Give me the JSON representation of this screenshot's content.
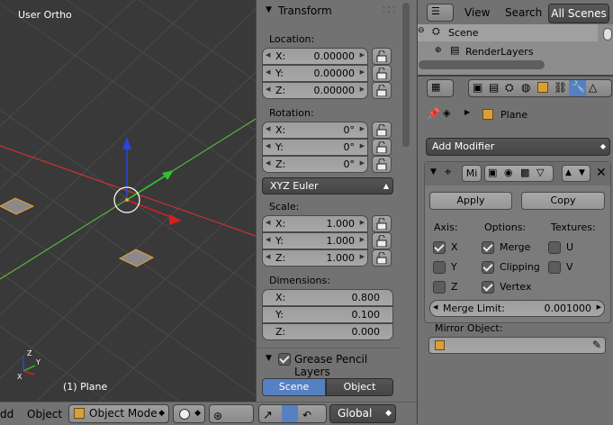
{
  "viewport": {
    "title": "User Ortho",
    "object_label": "(1) Plane"
  },
  "npanel": {
    "transform_title": "Transform",
    "location_label": "Location:",
    "location": [
      {
        "axis": "X:",
        "value": "0.00000"
      },
      {
        "axis": "Y:",
        "value": "0.00000"
      },
      {
        "axis": "Z:",
        "value": "0.00000"
      }
    ],
    "rotation_label": "Rotation:",
    "rotation": [
      {
        "axis": "X:",
        "value": "0°"
      },
      {
        "axis": "Y:",
        "value": "0°"
      },
      {
        "axis": "Z:",
        "value": "0°"
      }
    ],
    "rotation_mode": "XYZ Euler",
    "scale_label": "Scale:",
    "scale": [
      {
        "axis": "X:",
        "value": "1.000"
      },
      {
        "axis": "Y:",
        "value": "1.000"
      },
      {
        "axis": "Z:",
        "value": "1.000"
      }
    ],
    "dimensions_label": "Dimensions:",
    "dimensions": [
      {
        "axis": "X:",
        "value": "0.800"
      },
      {
        "axis": "Y:",
        "value": "0.100"
      },
      {
        "axis": "Z:",
        "value": "0.000"
      }
    ],
    "grease_title": "Grease Pencil Layers",
    "grease_tabs": [
      "Scene",
      "Object"
    ]
  },
  "header": {
    "add_menu": "dd",
    "object_menu": "Object",
    "mode": "Object Mode",
    "orientation": "Global"
  },
  "outliner": {
    "view_menu": "View",
    "search_menu": "Search",
    "filter": "All Scenes",
    "rows": [
      "Scene",
      "RenderLayers"
    ]
  },
  "properties": {
    "context_object": "Plane",
    "add_modifier": "Add Modifier",
    "modifier_short_name": "Mi",
    "apply_button": "Apply",
    "copy_button": "Copy",
    "axis_label": "Axis:",
    "options_label": "Options:",
    "textures_label": "Textures:",
    "axis": [
      {
        "label": "X",
        "checked": true
      },
      {
        "label": "Y",
        "checked": false
      },
      {
        "label": "Z",
        "checked": false
      }
    ],
    "options": [
      {
        "label": "Merge",
        "checked": true
      },
      {
        "label": "Clipping",
        "checked": true
      },
      {
        "label": "Vertex",
        "checked": true
      }
    ],
    "textures": [
      {
        "label": "U",
        "checked": false
      },
      {
        "label": "V",
        "checked": false
      }
    ],
    "merge_limit_label": "Merge Limit:",
    "merge_limit_value": "0.001000",
    "mirror_object_label": "Mirror Object:"
  },
  "colors": {
    "viewport_bg": "#393939",
    "x_axis": "#c83232",
    "y_axis": "#5ab43c",
    "selected_outline": "#f0a030",
    "active_tab": "#5680c2"
  }
}
